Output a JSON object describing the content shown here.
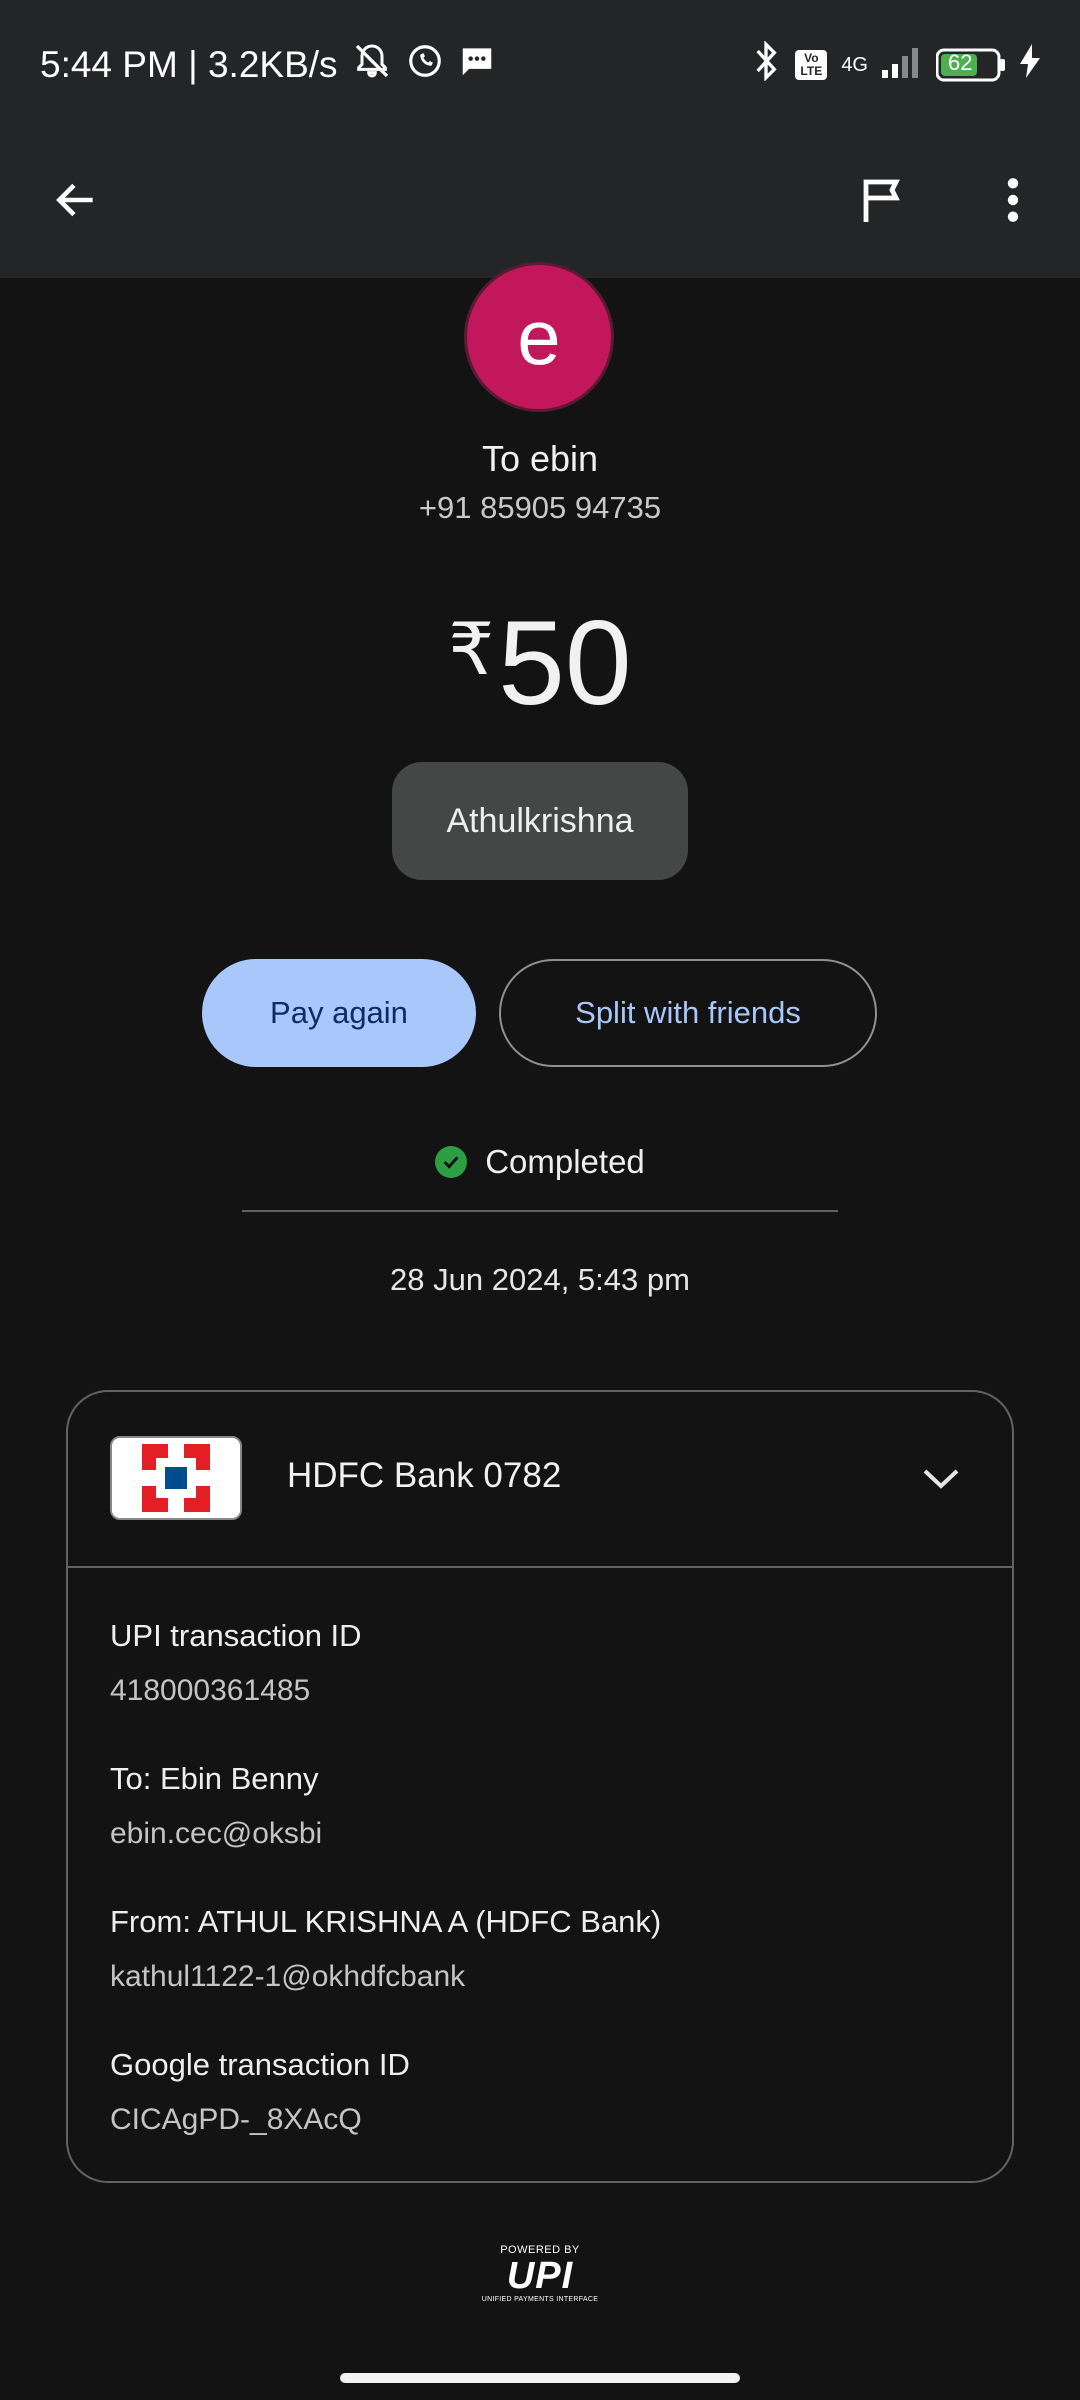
{
  "status_bar": {
    "time_speed": "5:44 PM | 3.2KB/s",
    "network": "4G",
    "volte": "Vo LTE",
    "battery": "62"
  },
  "icons": {
    "back": "arrow-left-icon",
    "report": "flag-icon",
    "menu": "more-vert-icon"
  },
  "recipient": {
    "avatar_letter": "e",
    "avatar_color": "#c2185b",
    "title": "To ebin",
    "phone": "+91 85905 94735"
  },
  "payment": {
    "currency": "₹",
    "amount": "50",
    "note": "Athulkrishna"
  },
  "actions": {
    "pay_again": "Pay again",
    "split": "Split with friends"
  },
  "status": {
    "label": "Completed",
    "color": "#2e9e45",
    "datetime": "28 Jun 2024, 5:43 pm"
  },
  "details": {
    "bank_name": "HDFC Bank 0782",
    "upi_id_label": "UPI transaction ID",
    "upi_id_value": "418000361485",
    "to_label": "To: Ebin  Benny",
    "to_value": "ebin.cec@oksbi",
    "from_label": "From: ATHUL KRISHNA A (HDFC Bank)",
    "from_value": "kathul1122-1@okhdfcbank",
    "google_id_label": "Google transaction ID",
    "google_id_value": "CICAgPD-_8XAcQ"
  },
  "footer": {
    "powered_by": "POWERED BY",
    "upi": "UPI",
    "upi_full": "UNIFIED PAYMENTS INTERFACE"
  },
  "colors": {
    "accent": "#a8c7fa",
    "background": "#131313",
    "bar": "#242526"
  }
}
